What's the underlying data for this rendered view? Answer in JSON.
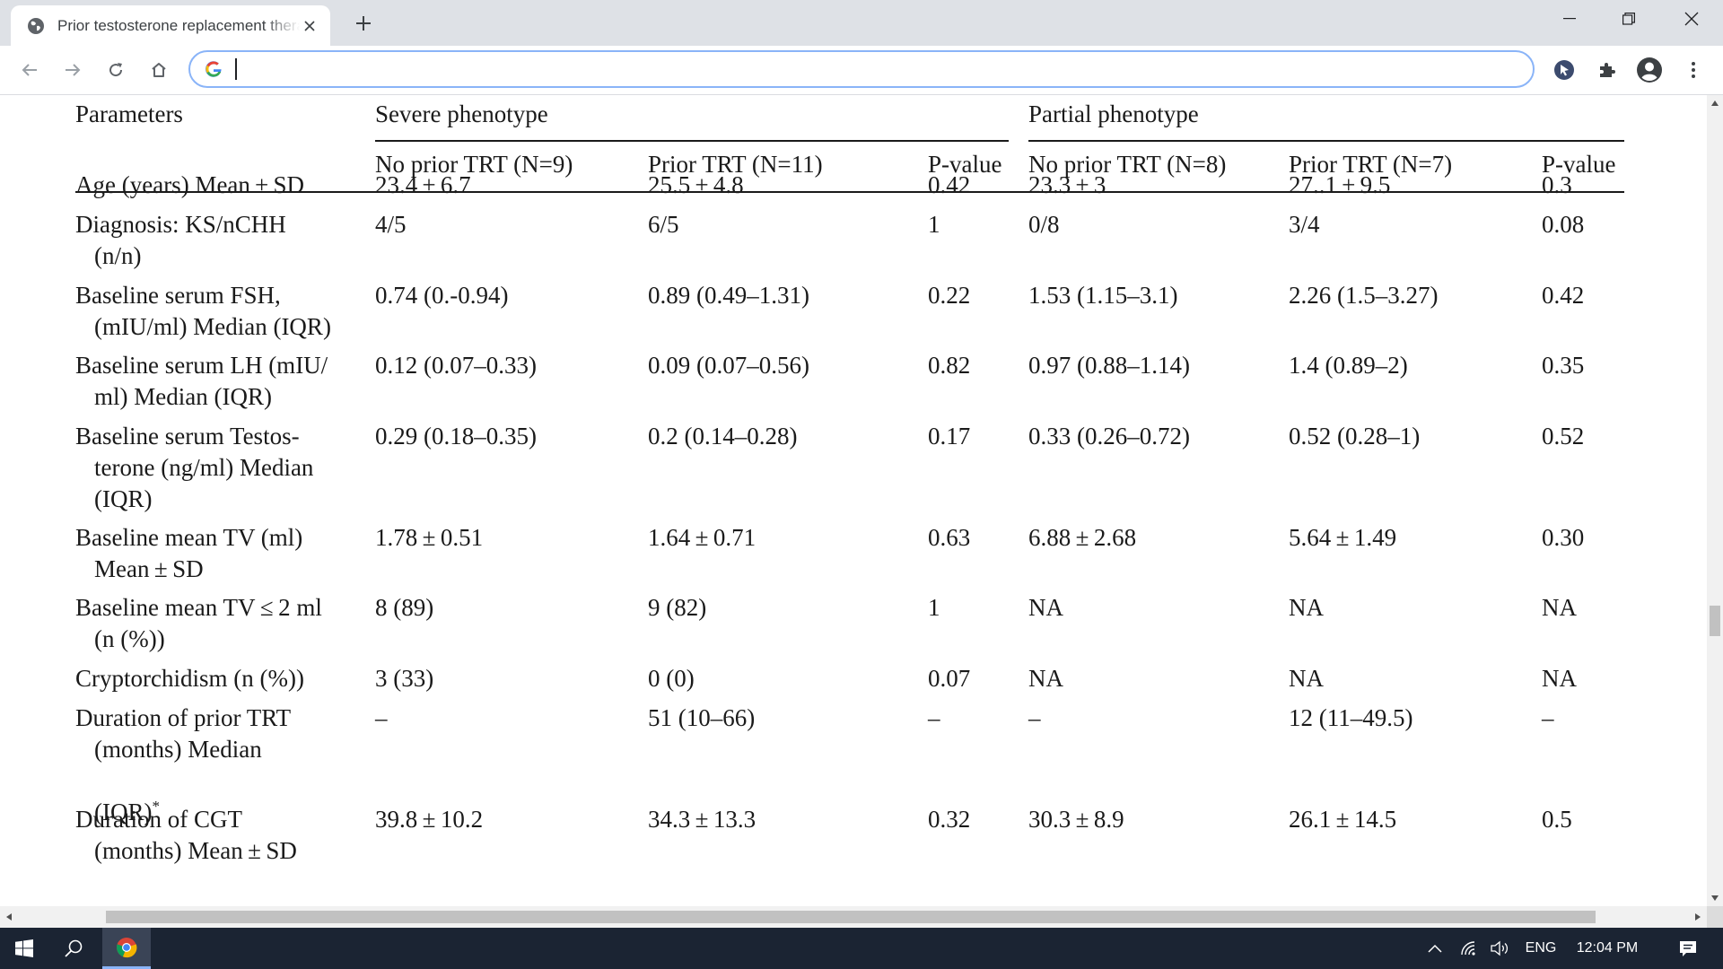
{
  "browser": {
    "tab_title": "Prior testosterone replacement therapy",
    "new_tab_symbol": "+",
    "omnibox_value": "",
    "icons": [
      "globe-icon",
      "close-icon",
      "plus-icon",
      "minimize-icon",
      "restore-icon",
      "window-close-icon",
      "back-arrow-icon",
      "forward-arrow-icon",
      "reload-icon",
      "home-icon",
      "google-g-icon",
      "cursor-extension-icon",
      "puzzle-extensions-icon",
      "profile-icon",
      "kebab-menu-icon"
    ]
  },
  "table": {
    "col_parameters": "Parameters",
    "group_severe": "Severe phenotype",
    "group_partial": "Partial phenotype",
    "sub_headers": [
      "No prior TRT (N=9)",
      "Prior TRT (N=11)",
      "P-value",
      "No prior TRT (N=8)",
      "Prior TRT (N=7)",
      "P-value"
    ],
    "rows": [
      {
        "p1": "Age (years) Mean ± SD",
        "p2": "",
        "p3": "",
        "v": [
          "23.4 ± 6.7",
          "25.5 ± 4.8",
          "0.42",
          "23.3 ± 3",
          "27..1 ± 9.5",
          "0.3"
        ]
      },
      {
        "p1": "Diagnosis: KS/nCHH",
        "p2": "(n/n)",
        "p3": "",
        "v": [
          "4/5",
          "6/5",
          "1",
          "0/8",
          "3/4",
          "0.08"
        ]
      },
      {
        "p1": "Baseline serum FSH,",
        "p2": "(mIU/ml) Median (IQR)",
        "p3": "",
        "v": [
          "0.74 (0.-0.94)",
          "0.89 (0.49–1.31)",
          "0.22",
          "1.53 (1.15–3.1)",
          "2.26 (1.5–3.27)",
          "0.42"
        ]
      },
      {
        "p1": "Baseline serum LH (mIU/",
        "p2": "ml) Median (IQR)",
        "p3": "",
        "v": [
          "0.12 (0.07–0.33)",
          "0.09 (0.07–0.56)",
          "0.82",
          "0.97 (0.88–1.14)",
          "1.4 (0.89–2)",
          "0.35"
        ]
      },
      {
        "p1": "Baseline serum Testos-",
        "p2": "terone (ng/ml) Median",
        "p3": "(IQR)",
        "v": [
          "0.29 (0.18–0.35)",
          "0.2 (0.14–0.28)",
          "0.17",
          "0.33 (0.26–0.72)",
          "0.52 (0.28–1)",
          "0.52"
        ]
      },
      {
        "p1": "Baseline mean TV (ml)",
        "p2": "Mean ± SD",
        "p3": "",
        "v": [
          "1.78 ± 0.51",
          "1.64 ± 0.71",
          "0.63",
          "6.88 ± 2.68",
          "5.64 ± 1.49",
          "0.30"
        ]
      },
      {
        "p1": "Baseline mean TV ≤ 2 ml",
        "p2": "(n (%))",
        "p3": "",
        "v": [
          "8 (89)",
          "9 (82)",
          "1",
          "NA",
          "NA",
          "NA"
        ]
      },
      {
        "p1": "Cryptorchidism (n (%))",
        "p2": "",
        "p3": "",
        "v": [
          "3 (33)",
          "0 (0)",
          "0.07",
          "NA",
          "NA",
          "NA"
        ]
      },
      {
        "p1": "Duration of prior TRT",
        "p2": "(months) Median",
        "p3": "(IQR)",
        "sup": "*",
        "v": [
          "–",
          "51 (10–66)",
          "–",
          "–",
          "12 (11–49.5)",
          "–"
        ]
      },
      {
        "p1": "Duration of CGT",
        "p2": "(months) Mean ± SD",
        "p3": "",
        "v": [
          "39.8 ± 10.2",
          "34.3 ± 13.3",
          "0.32",
          "30.3 ± 8.9",
          "26.1 ± 14.5",
          "0.5"
        ]
      }
    ]
  },
  "taskbar": {
    "language": "ENG",
    "clock": "12:04 PM",
    "icons": [
      "windows-start-icon",
      "search-icon",
      "chrome-icon",
      "chevron-up-icon",
      "wifi-icon",
      "volume-icon",
      "notification-icon"
    ]
  },
  "colors": {
    "accent_focus": "#8ab4f8",
    "tabstrip": "#dee1e6",
    "taskbar": "#1b2433"
  }
}
